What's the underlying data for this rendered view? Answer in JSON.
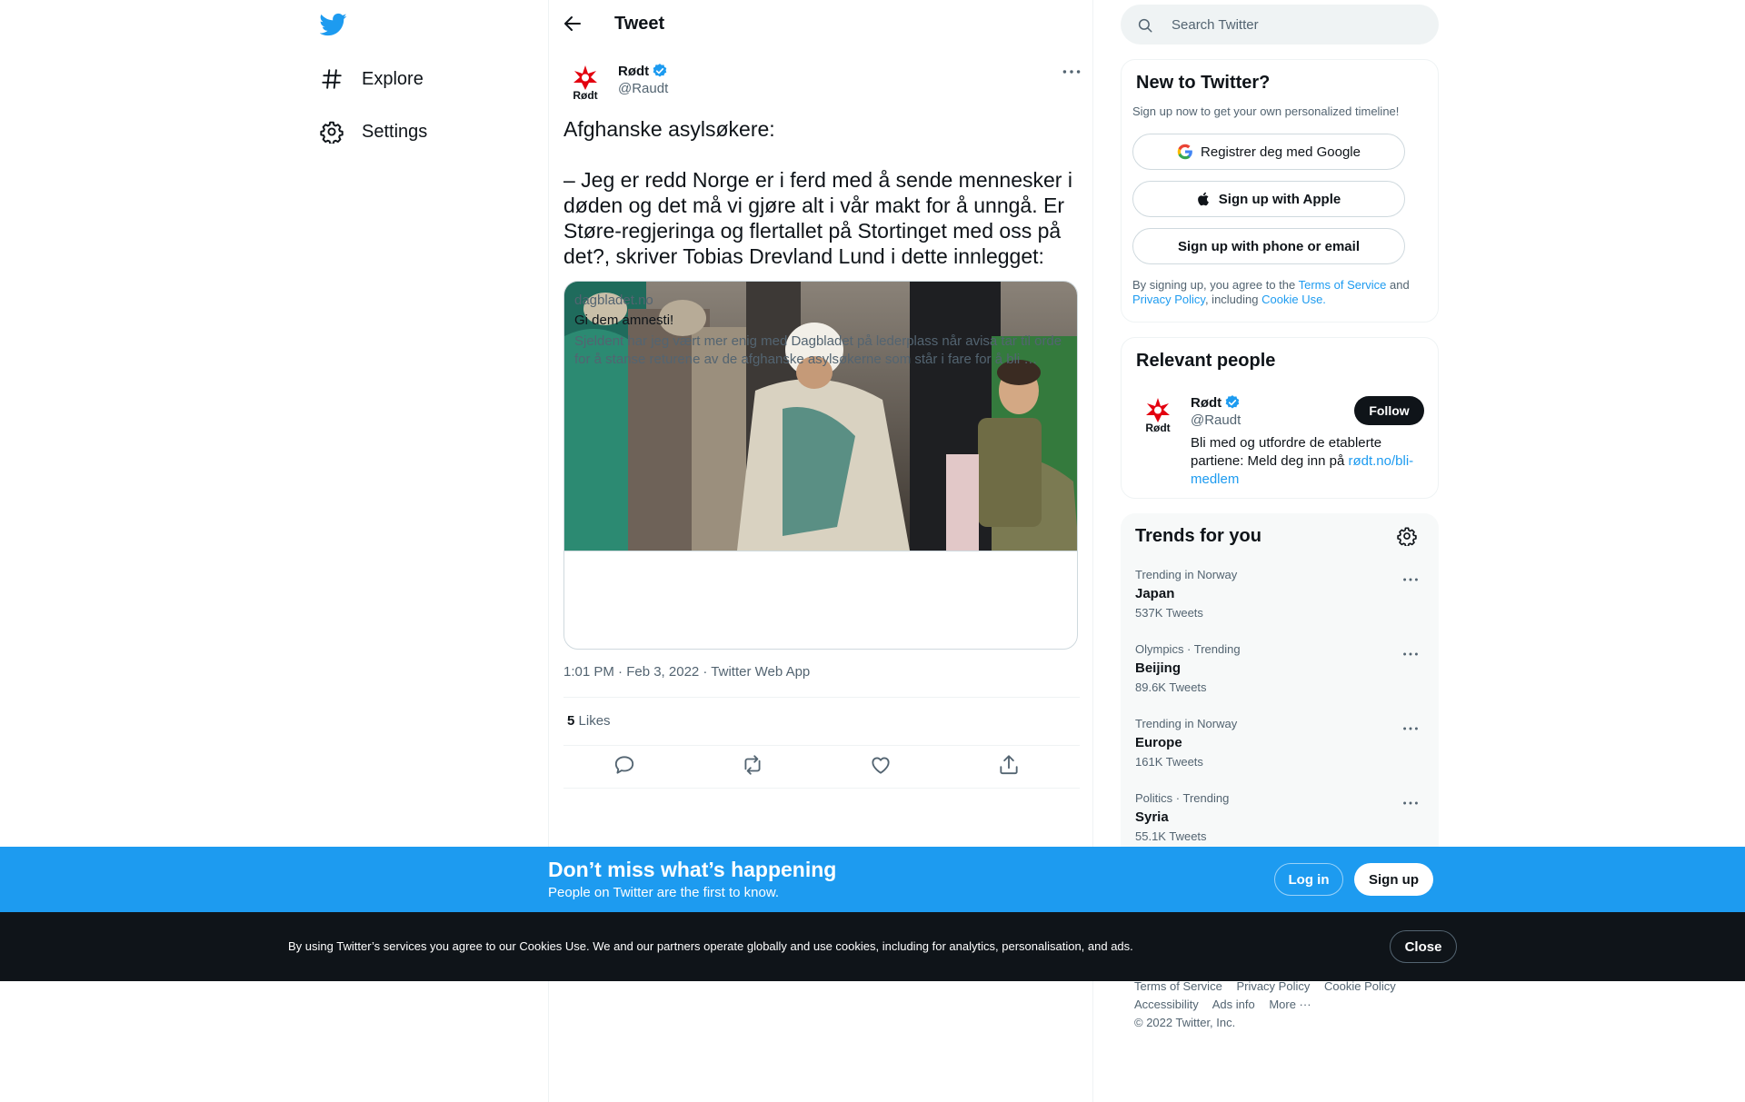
{
  "nav": {
    "logo_icon": "twitter-bird-icon",
    "items": [
      {
        "label": "Explore",
        "icon": "hashtag-icon"
      },
      {
        "label": "Settings",
        "icon": "gear-icon"
      }
    ]
  },
  "header": {
    "title": "Tweet"
  },
  "tweet": {
    "author": {
      "name": "Rødt",
      "handle": "@Raudt",
      "avatar_text": "Rødt",
      "verified": true
    },
    "text": "Afghanske asylsøkere:\n\n– Jeg er redd Norge er i ferd med å sende mennesker i døden og det må vi gjøre alt i vår makt for å unngå. Er Støre-regjeringa og flertallet på Stortinget med oss på det?, skriver Tobias Drevland Lund i dette innlegget:",
    "card": {
      "domain": "dagbladet.no",
      "title": "Gi dem amnesti!",
      "description": "Sjeldent har jeg vært mer enig med Dagbladet på lederplass når avisa tar til orde for å stanse returene av de afghanske asylsøkerne som står i fare for å bli …"
    },
    "timestamp": "1:01 PM · Feb 3, 2022 · Twitter Web App",
    "likes_count": "5",
    "likes_label": "Likes"
  },
  "search": {
    "placeholder": "Search Twitter"
  },
  "new_to_twitter": {
    "title": "New to Twitter?",
    "subtitle": "Sign up now to get your own personalized timeline!",
    "google_label": "Registrer deg med Google",
    "apple_label": "Sign up with Apple",
    "phone_label": "Sign up with phone or email",
    "legal_prefix": "By signing up, you agree to the ",
    "terms": "Terms of Service",
    "and": " and ",
    "privacy": "Privacy Policy",
    "including": ", including ",
    "cookie_use": "Cookie Use."
  },
  "relevant_people": {
    "title": "Relevant people",
    "name": "Rødt",
    "handle": "@Raudt",
    "follow_label": "Follow",
    "bio_text": "Bli med og utfordre de etablerte partiene: Meld deg inn på ",
    "bio_link": "rødt.no/bli-medlem"
  },
  "trends": {
    "title": "Trends for you",
    "items": [
      {
        "context": "Trending in Norway",
        "name": "Japan",
        "count": "537K Tweets"
      },
      {
        "context": "Olympics · Trending",
        "name": "Beijing",
        "count": "89.6K Tweets"
      },
      {
        "context": "Trending in Norway",
        "name": "Europe",
        "count": "161K Tweets"
      },
      {
        "context": "Politics · Trending",
        "name": "Syria",
        "count": "55.1K Tweets"
      }
    ]
  },
  "footer": {
    "terms": "Terms of Service",
    "privacy": "Privacy Policy",
    "cookie": "Cookie Policy",
    "accessibility": "Accessibility",
    "ads": "Ads info",
    "more": "More ···",
    "copyright": "© 2022 Twitter, Inc."
  },
  "banner": {
    "title": "Don’t miss what’s happening",
    "subtitle": "People on Twitter are the first to know.",
    "login_label": "Log in",
    "signup_label": "Sign up"
  },
  "cookie_bar": {
    "text": "By using Twitter’s services you agree to our Cookies Use. We and our partners operate globally and use cookies, including for analytics, personalisation, and ads.",
    "close_label": "Close"
  },
  "colors": {
    "accent": "#1d9bf0",
    "text": "#0f1419",
    "muted": "#536471",
    "cookie_bg": "#0f1419",
    "rodt_red": "#e3000f"
  }
}
